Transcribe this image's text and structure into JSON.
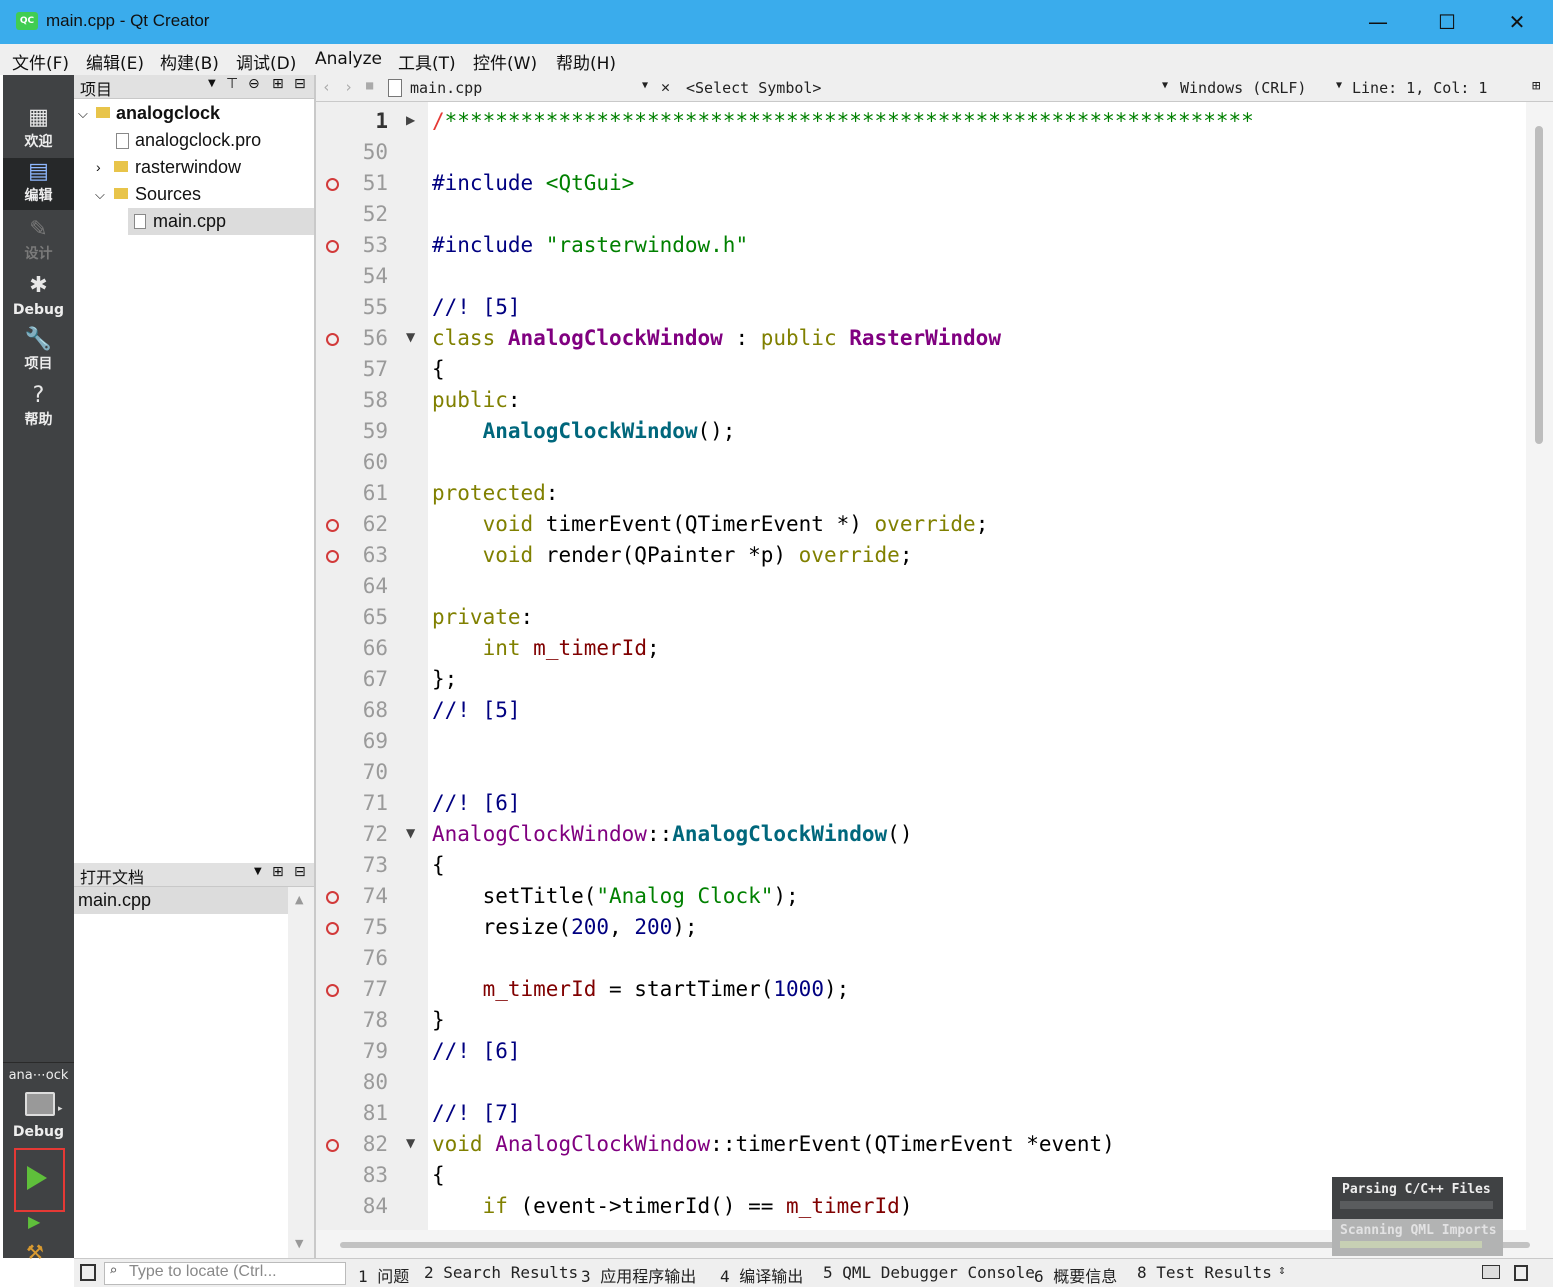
{
  "window": {
    "title": "main.cpp - Qt Creator",
    "app_icon": "QC",
    "min": "—",
    "max": "☐",
    "close": "✕"
  },
  "menu": [
    "文件(F)",
    "编辑(E)",
    "构建(B)",
    "调试(D)",
    "Analyze",
    "工具(T)",
    "控件(W)",
    "帮助(H)"
  ],
  "modes": [
    {
      "label": "欢迎",
      "icon": "grid-icon"
    },
    {
      "label": "编辑",
      "icon": "edit-doc-icon"
    },
    {
      "label": "设计",
      "icon": "pencil-icon"
    },
    {
      "label": "Debug",
      "icon": "bug-icon"
    },
    {
      "label": "项目",
      "icon": "wrench-icon"
    },
    {
      "label": "帮助",
      "icon": "help-icon"
    }
  ],
  "kit": {
    "project": "ana⋯ock",
    "config": "Debug"
  },
  "projects_pane": {
    "title": "项目",
    "tree": [
      "analogclock",
      "analogclock.pro",
      "rasterwindow",
      "Sources",
      "main.cpp"
    ]
  },
  "open_docs_pane": {
    "title": "打开文档",
    "docs": [
      "main.cpp"
    ]
  },
  "editor": {
    "file": "main.cpp",
    "symbol": "<Select Symbol>",
    "line_ending": "Windows (CRLF)",
    "position": "Line: 1, Col: 1"
  },
  "code": {
    "line_numbers": [
      "1",
      "50",
      "51",
      "52",
      "53",
      "54",
      "55",
      "56",
      "57",
      "58",
      "59",
      "60",
      "61",
      "62",
      "63",
      "64",
      "65",
      "66",
      "67",
      "68",
      "69",
      "70",
      "71",
      "72",
      "73",
      "74",
      "75",
      "76",
      "77",
      "78",
      "79",
      "80",
      "81",
      "82",
      "83",
      "84"
    ],
    "breakpoint_lines": [
      "51",
      "53",
      "56",
      "62",
      "63",
      "74",
      "75",
      "77",
      "82"
    ],
    "fold_lines": [
      "1",
      "56",
      "72",
      "82"
    ],
    "first_line": "/*****************************************************************"
  },
  "progress": {
    "parsing": "Parsing C/C++ Files",
    "scanning": "Scanning QML Imports"
  },
  "status": {
    "locator_placeholder": "Type to locate (Ctrl...",
    "tabs": [
      "1 问题",
      "2 Search Results",
      "3 应用程序输出",
      "4 编译输出",
      "5 QML Debugger Console",
      "6 概要信息",
      "8 Test Results"
    ]
  }
}
